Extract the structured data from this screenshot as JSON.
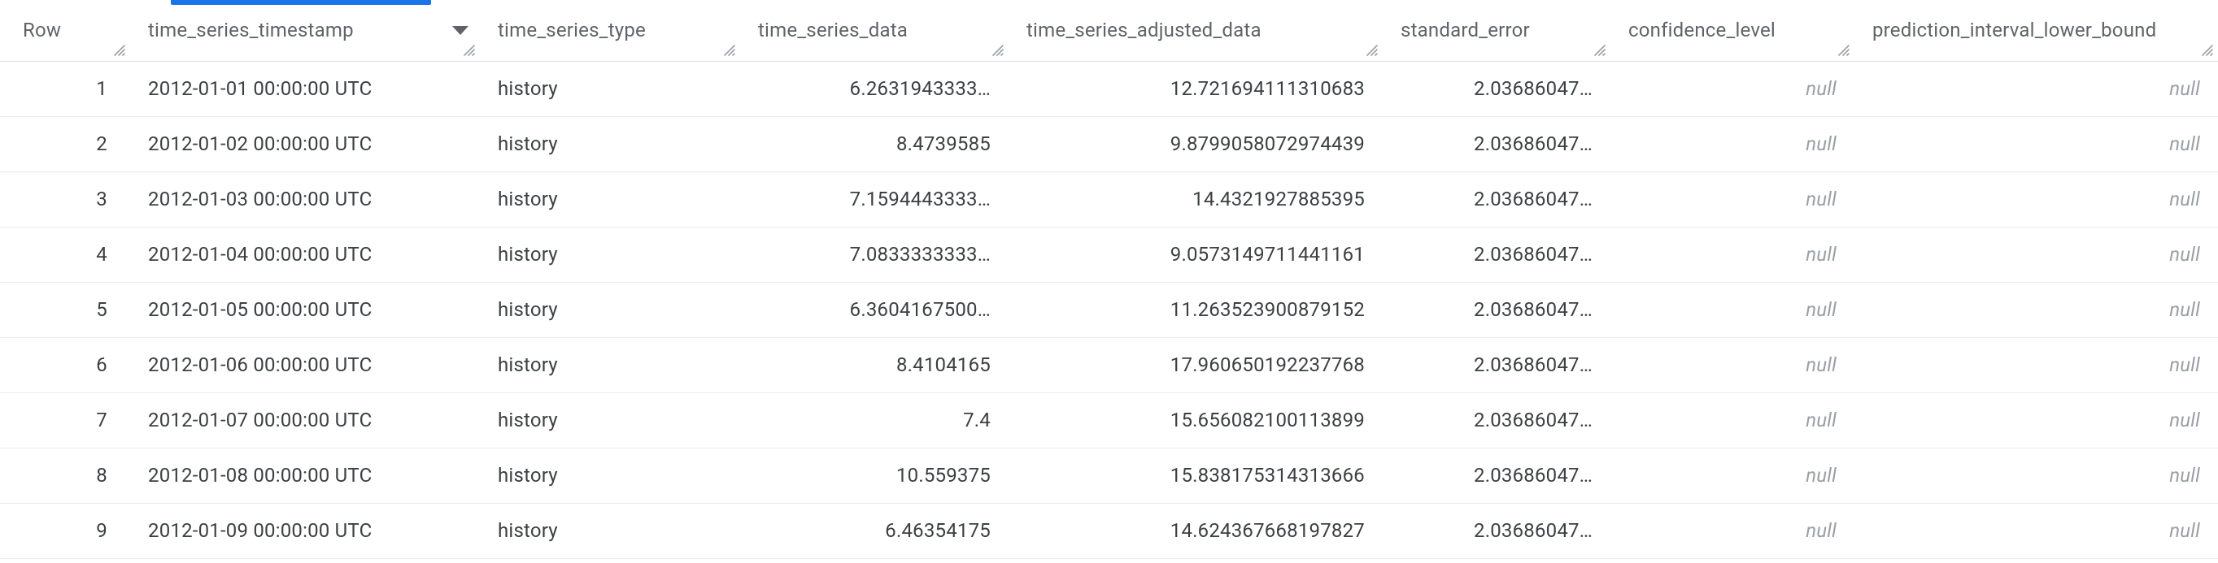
{
  "columns": {
    "row": "Row",
    "timestamp": "time_series_timestamp",
    "type": "time_series_type",
    "data": "time_series_data",
    "adjusted": "time_series_adjusted_data",
    "stderr": "standard_error",
    "conf": "confidence_level",
    "pilb": "prediction_interval_lower_bound"
  },
  "sort": {
    "column": "time_series_timestamp",
    "dir": "desc_icon_shown"
  },
  "null_label": "null",
  "rows": [
    {
      "idx": "1",
      "timestamp": "2012-01-01 00:00:00 UTC",
      "type": "history",
      "data": "6.2631943333…",
      "adjusted": "12.721694111310683",
      "stderr": "2.03686047…",
      "conf": null,
      "pilb": null
    },
    {
      "idx": "2",
      "timestamp": "2012-01-02 00:00:00 UTC",
      "type": "history",
      "data": "8.4739585",
      "adjusted": "9.8799058072974439",
      "stderr": "2.03686047…",
      "conf": null,
      "pilb": null
    },
    {
      "idx": "3",
      "timestamp": "2012-01-03 00:00:00 UTC",
      "type": "history",
      "data": "7.1594443333…",
      "adjusted": "14.4321927885395",
      "stderr": "2.03686047…",
      "conf": null,
      "pilb": null
    },
    {
      "idx": "4",
      "timestamp": "2012-01-04 00:00:00 UTC",
      "type": "history",
      "data": "7.0833333333…",
      "adjusted": "9.0573149711441161",
      "stderr": "2.03686047…",
      "conf": null,
      "pilb": null
    },
    {
      "idx": "5",
      "timestamp": "2012-01-05 00:00:00 UTC",
      "type": "history",
      "data": "6.3604167500…",
      "adjusted": "11.263523900879152",
      "stderr": "2.03686047…",
      "conf": null,
      "pilb": null
    },
    {
      "idx": "6",
      "timestamp": "2012-01-06 00:00:00 UTC",
      "type": "history",
      "data": "8.4104165",
      "adjusted": "17.960650192237768",
      "stderr": "2.03686047…",
      "conf": null,
      "pilb": null
    },
    {
      "idx": "7",
      "timestamp": "2012-01-07 00:00:00 UTC",
      "type": "history",
      "data": "7.4",
      "adjusted": "15.656082100113899",
      "stderr": "2.03686047…",
      "conf": null,
      "pilb": null
    },
    {
      "idx": "8",
      "timestamp": "2012-01-08 00:00:00 UTC",
      "type": "history",
      "data": "10.559375",
      "adjusted": "15.838175314313666",
      "stderr": "2.03686047…",
      "conf": null,
      "pilb": null
    },
    {
      "idx": "9",
      "timestamp": "2012-01-09 00:00:00 UTC",
      "type": "history",
      "data": "6.46354175",
      "adjusted": "14.624367668197827",
      "stderr": "2.03686047…",
      "conf": null,
      "pilb": null
    }
  ]
}
